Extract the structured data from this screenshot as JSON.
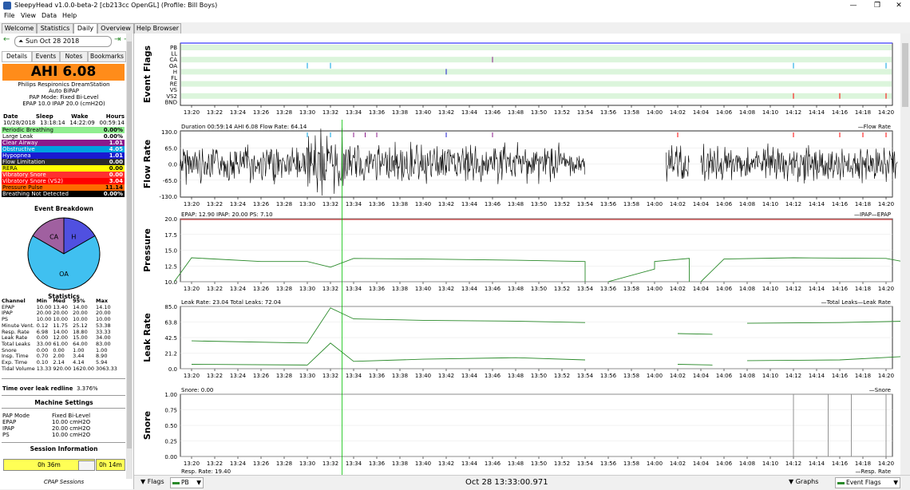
{
  "window": {
    "title": "SleepyHead v1.0.0-beta-2 [cb213cc OpenGL] (Profile: Bill Boys)",
    "controls": [
      "—",
      "❐",
      "✕"
    ]
  },
  "menu": [
    "File",
    "View",
    "Data",
    "Help"
  ],
  "tabs": [
    "Welcome",
    "Statistics",
    "Daily",
    "Overview",
    "Help Browser"
  ],
  "nav": {
    "date": "Sun Oct 28 2018",
    "back": "←",
    "forward": "→",
    "jump": "⇥"
  },
  "subtabs": [
    "Details",
    "Events",
    "Notes",
    "Bookmarks"
  ],
  "ahi": "AHI 6.08",
  "machine": {
    "name": "Philips Respironics DreamStation",
    "model": "Auto BiPAP",
    "mode": "PAP Mode: Fixed Bi-Level",
    "pressures": "EPAP 10.0 IPAP 20.0 (cmH2O)"
  },
  "times": {
    "headers": [
      "Date",
      "Sleep",
      "Wake",
      "Hours"
    ],
    "values": [
      "10/28/2018",
      "13:18:14",
      "14:22:09",
      "00:59:14"
    ]
  },
  "events": [
    {
      "label": "Periodic Breathing",
      "value": "0.00%",
      "color": "#90ee90"
    },
    {
      "label": "Large Leak",
      "value": "0.00%",
      "color": "#ffffff"
    },
    {
      "label": "Clear Airway",
      "value": "1.01",
      "color": "#8b1a8b"
    },
    {
      "label": "Obstructive",
      "value": "4.05",
      "color": "#00a0e0"
    },
    {
      "label": "Hypopnea",
      "value": "1.01",
      "color": "#1a1ad0"
    },
    {
      "label": "Flow Limitation",
      "value": "0.00",
      "color": "#2a2a2a"
    },
    {
      "label": "RERA",
      "value": "0.00",
      "color": "#ffff00"
    },
    {
      "label": "Vibratory Snore",
      "value": "0.00",
      "color": "#ff3030"
    },
    {
      "label": "Vibratory Snore (VS2)",
      "value": "3.04",
      "color": "#ff0000"
    },
    {
      "label": "Pressure Pulse",
      "value": "11.14",
      "color": "#ff6a00"
    },
    {
      "label": "Breathing Not Detected",
      "value": "0.00%",
      "color": "#000000"
    }
  ],
  "breakdown": {
    "title": "Event Breakdown",
    "slices": [
      {
        "label": "CA",
        "value": 1,
        "color": "#a060a0"
      },
      {
        "label": "H",
        "value": 1,
        "color": "#5050e0"
      },
      {
        "label": "OA",
        "value": 4,
        "color": "#40c0f0"
      }
    ]
  },
  "stats": {
    "title": "Statistics",
    "headers": [
      "Channel",
      "Min",
      "Med",
      "95%",
      "Max"
    ],
    "rows": [
      [
        "EPAP",
        "10.00",
        "13.40",
        "14.00",
        "14.10"
      ],
      [
        "IPAP",
        "20.00",
        "20.00",
        "20.00",
        "20.00"
      ],
      [
        "PS",
        "10.00",
        "10.00",
        "10.00",
        "10.00"
      ],
      [
        "Minute Vent.",
        "0.12",
        "11.75",
        "25.12",
        "53.38"
      ],
      [
        "Resp. Rate",
        "6.98",
        "14.00",
        "18.80",
        "33.33"
      ],
      [
        "Leak Rate",
        "0.00",
        "12.00",
        "15.00",
        "34.00"
      ],
      [
        "Total Leaks",
        "33.00",
        "61.00",
        "64.00",
        "83.00"
      ],
      [
        "Snore",
        "0.00",
        "0.00",
        "1.00",
        "1.00"
      ],
      [
        "Insp. Time",
        "0.70",
        "2.00",
        "3.44",
        "8.90"
      ],
      [
        "Exp. Time",
        "0.10",
        "2.14",
        "4.14",
        "5.94"
      ],
      [
        "Tidal Volume",
        "13.33",
        "920.00",
        "1620.00",
        "3063.33"
      ]
    ]
  },
  "leak_redline": {
    "label": "Time over leak redline",
    "value": "3.376%"
  },
  "machine_settings": {
    "title": "Machine Settings",
    "rows": [
      [
        "PAP Mode",
        "Fixed Bi-Level"
      ],
      [
        "EPAP",
        "10.00 cmH2O"
      ],
      [
        "IPAP",
        "20.00 cmH2O"
      ],
      [
        "PS",
        "10.00 cmH2O"
      ]
    ]
  },
  "session": {
    "title": "Session Information",
    "left": "0h 36m",
    "right": "0h 14m",
    "caption": "CPAP Sessions"
  },
  "graphs": {
    "time_ticks": [
      "13:20",
      "13:22",
      "13:24",
      "13:26",
      "13:28",
      "13:30",
      "13:32",
      "13:34",
      "13:36",
      "13:38",
      "13:40",
      "13:42",
      "13:44",
      "13:46",
      "13:48",
      "13:50",
      "13:52",
      "13:54",
      "13:56",
      "13:58",
      "14:00",
      "14:02",
      "14:04",
      "14:06",
      "14:08",
      "14:10",
      "14:12",
      "14:14",
      "14:16",
      "14:18",
      "14:20"
    ],
    "event_flags": {
      "ylabel": "Event Flags",
      "rows": [
        "PB",
        "LL",
        "CA",
        "OA",
        "H",
        "FL",
        "RE",
        "VS",
        "VS2",
        "BND"
      ]
    },
    "flow": {
      "ylabel": "Flow Rate",
      "title": "Duration 00:59:14 AHI 6.08 Flow Rate: 64.14",
      "legend": "Flow Rate",
      "ticks": [
        "130.0",
        "65.0",
        "0.0",
        "-65.0",
        "-130.0"
      ]
    },
    "pressure": {
      "ylabel": "Pressure",
      "title": "EPAP: 12.90 IPAP: 20.00 PS: 7.10",
      "legend": "IPAP—EPAP",
      "ticks": [
        "20.0",
        "17.5",
        "15.0",
        "12.5",
        "10.0"
      ]
    },
    "leak": {
      "ylabel": "Leak Rate",
      "title": "Leak Rate: 23.04 Total Leaks: 72.04",
      "legend": "Total Leaks—Leak Rate",
      "ticks": [
        "85.0",
        "63.8",
        "42.5",
        "21.2",
        "0.0"
      ]
    },
    "snore": {
      "ylabel": "Snore",
      "title": "Snore: 0.00",
      "legend": "Snore",
      "ticks": [
        "1.00",
        "0.75",
        "0.50",
        "0.25",
        "0.00"
      ]
    },
    "resp_partial": "Resp. Rate: 19.40",
    "resp_legend": "Resp. Rate"
  },
  "bottom": {
    "flags": "Flags",
    "pb": "PB",
    "timestamp": "Oct 28 13:33:00.971",
    "graphs": "Graphs",
    "eventflags": "Event Flags"
  },
  "colors": {
    "ahi_bg": "#ff8c1a",
    "session_bar": "#ffff55",
    "cursor": "#00c000",
    "series": "#2a8a2a"
  }
}
